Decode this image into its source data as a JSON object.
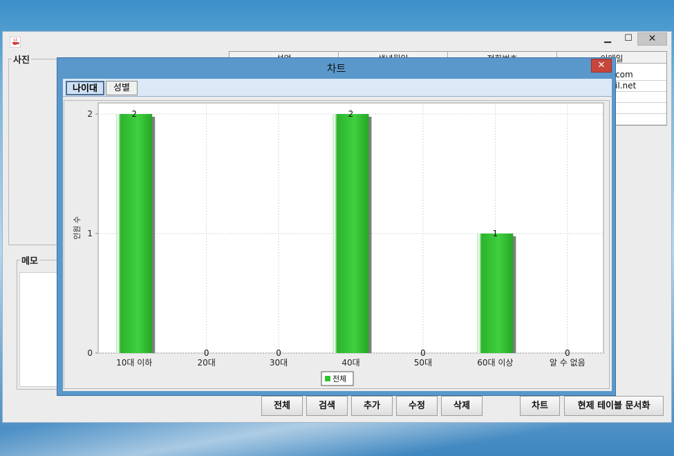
{
  "main_window": {
    "photo_group_label": "사진",
    "memo_group_label": "메모",
    "table": {
      "columns": [
        "성명",
        "생년월일",
        "전화번호",
        "이메일"
      ],
      "rows": [
        {
          "email": "com"
        },
        {
          "email": "il.net"
        },
        {
          "email": ""
        },
        {
          "email": ""
        },
        {
          "email": ""
        }
      ]
    },
    "buttons": {
      "all": "전체",
      "search": "검색",
      "add": "추가",
      "edit": "수정",
      "delete": "삭제",
      "chart": "차트",
      "export": "현제 테이블 문서화"
    }
  },
  "dialog": {
    "title": "차트",
    "tabs": [
      "나이대",
      "성별"
    ],
    "active_tab": 0
  },
  "chart_data": {
    "type": "bar",
    "categories": [
      "10대 이하",
      "20대",
      "30대",
      "40대",
      "50대",
      "60대 이상",
      "알 수 없음"
    ],
    "series": [
      {
        "name": "전체",
        "values": [
          2,
          0,
          0,
          2,
          0,
          1,
          0
        ],
        "color": "#2fc42f"
      }
    ],
    "xlabel": "",
    "ylabel": "인원 수",
    "ylim": [
      0,
      2
    ],
    "yticks": [
      0,
      1,
      2
    ],
    "grid": true,
    "legend": "bottom-center",
    "data_labels": true
  },
  "colors": {
    "bar": "#2fc42f",
    "bar_shadow": "#7e7e7e",
    "grid": "#d6d6d6"
  },
  "icons": {
    "app": "java-cup-icon",
    "close": "close-icon"
  }
}
